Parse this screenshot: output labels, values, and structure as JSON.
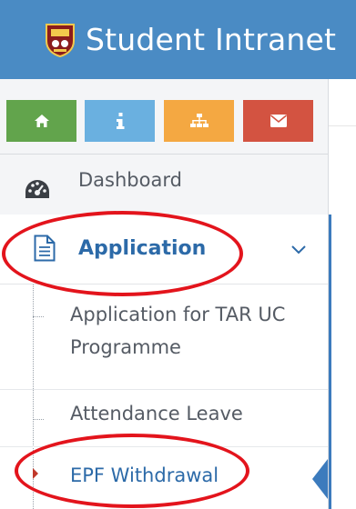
{
  "header": {
    "title": "Student Intranet",
    "colors": {
      "background": "#4a8bc4",
      "text": "#ffffff"
    }
  },
  "shortcuts": [
    {
      "icon": "home-icon",
      "color": "#62a44c"
    },
    {
      "icon": "info-icon",
      "color": "#6ab0e0"
    },
    {
      "icon": "sitemap-icon",
      "color": "#f4a842"
    },
    {
      "icon": "envelope-icon",
      "color": "#d35341"
    }
  ],
  "menu": {
    "dashboard": {
      "label": "Dashboard",
      "icon": "dashboard-icon"
    },
    "application": {
      "label": "Application",
      "icon": "document-icon",
      "expanded": true,
      "submenu": [
        {
          "label": "Application for TAR UC Programme"
        },
        {
          "label": "Attendance Leave"
        },
        {
          "label": "EPF Withdrawal",
          "active": true
        }
      ]
    }
  },
  "annotations": [
    {
      "type": "red-ellipse",
      "target": "Application"
    },
    {
      "type": "red-ellipse",
      "target": "EPF Withdrawal"
    }
  ]
}
